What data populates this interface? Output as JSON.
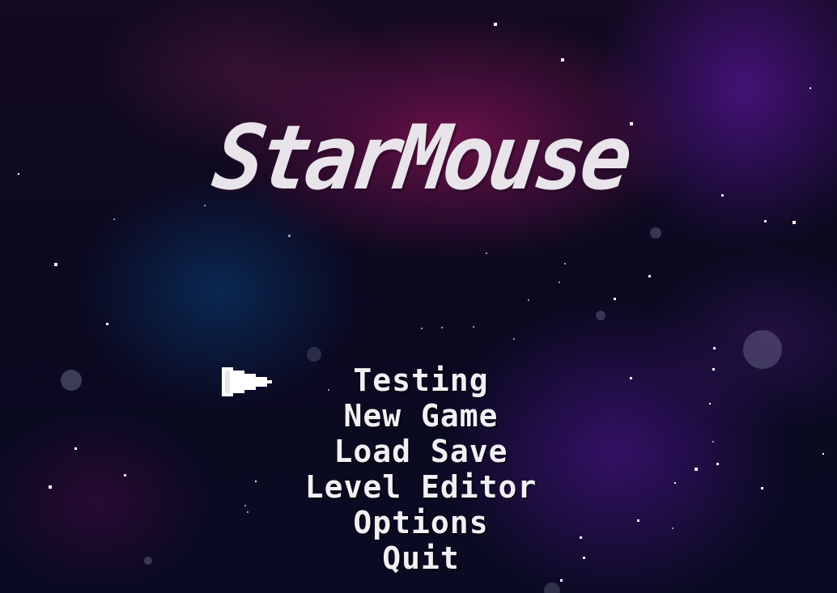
{
  "title": "StarMouse",
  "menu": {
    "items": [
      {
        "label": "Testing"
      },
      {
        "label": "New Game"
      },
      {
        "label": "Load Save"
      },
      {
        "label": "Level Editor"
      },
      {
        "label": "Options"
      },
      {
        "label": "Quit"
      }
    ],
    "selected_index": 0
  },
  "cursor_icon": "arrow-pointer-icon",
  "colors": {
    "text": "#f2f0f4",
    "title": "#e8e4ea",
    "nebula_magenta": "#78124e",
    "nebula_blue": "#0a2d5a",
    "nebula_purple": "#50148c",
    "space": "#0b0920"
  }
}
